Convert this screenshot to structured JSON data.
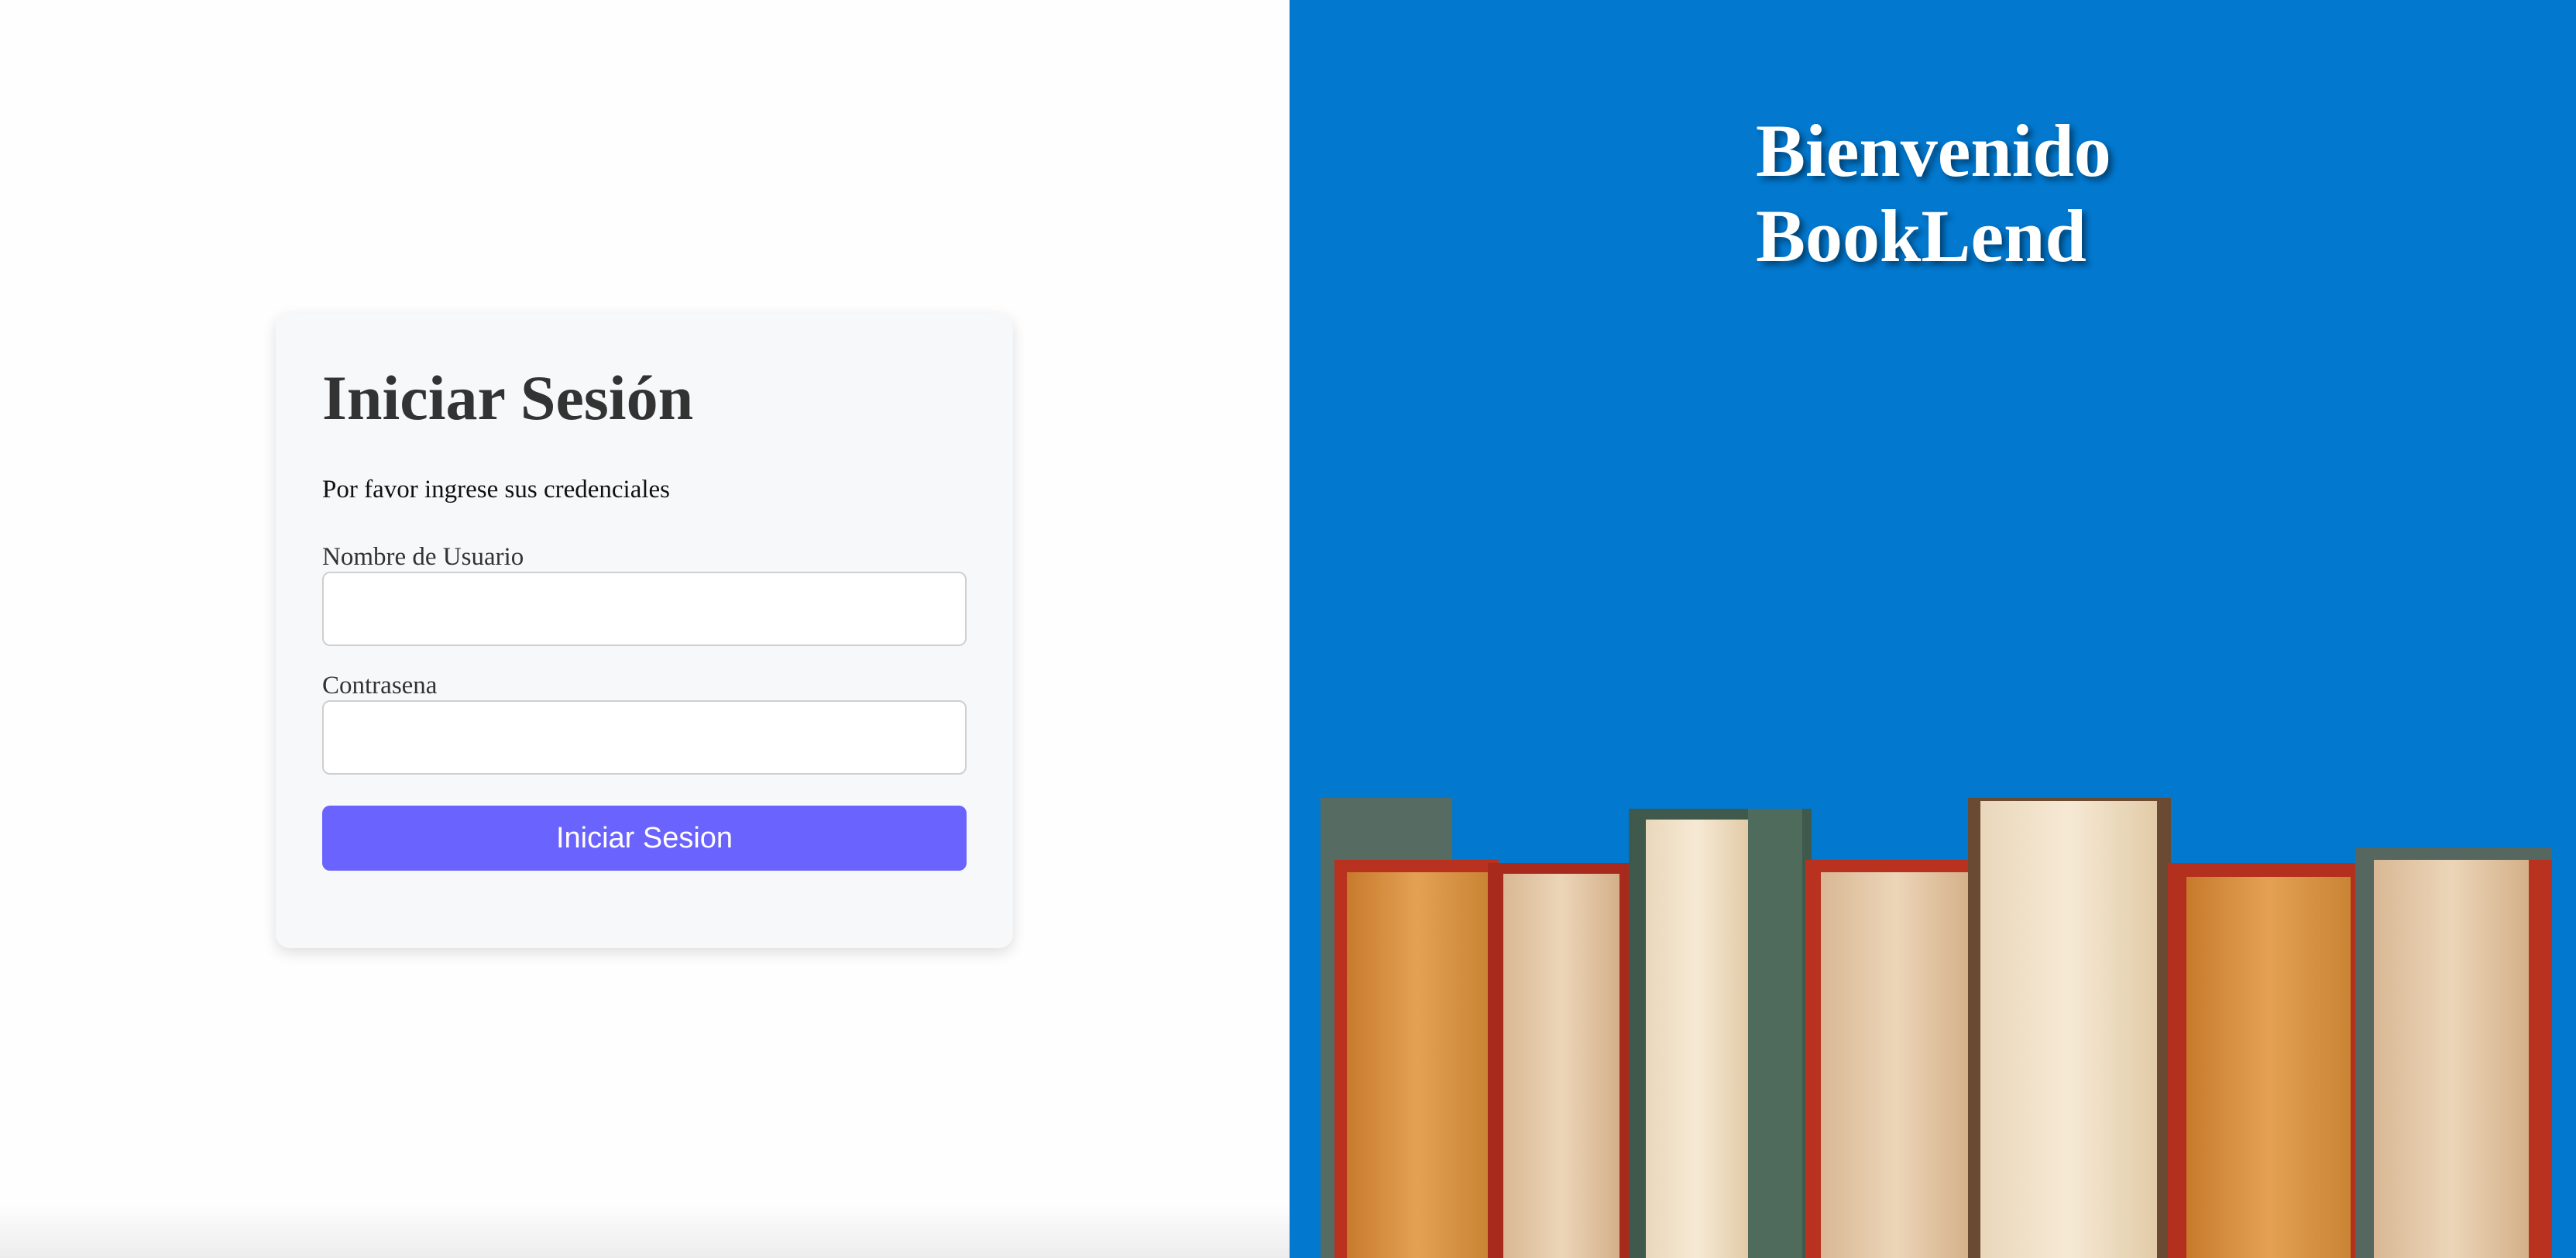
{
  "login": {
    "title": "Iniciar Sesión",
    "subtitle": "Por favor ingrese sus credenciales",
    "username_label": "Nombre de Usuario",
    "username_value": "",
    "password_label": "Contrasena",
    "password_value": "",
    "submit_label": "Iniciar Sesion"
  },
  "welcome": {
    "line1": "Bienvenido",
    "line2": "BookLend"
  },
  "colors": {
    "right_panel_bg": "#0278cf",
    "button_bg": "#6b63fe",
    "card_bg": "#f7f8f9"
  },
  "icons": {
    "illustration": "books-on-shelf-illustration"
  }
}
